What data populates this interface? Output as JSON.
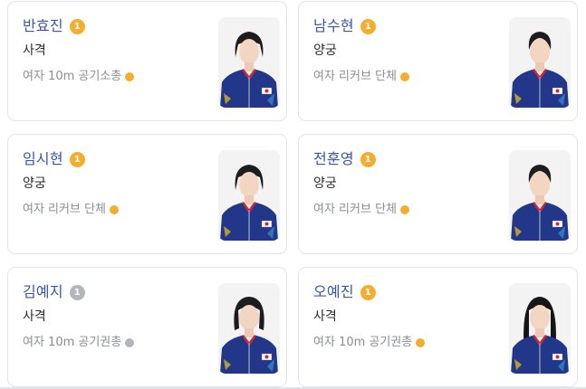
{
  "colors": {
    "gold": "#f5ad2e",
    "silver": "#b3b6ba",
    "name": "#3a56a8"
  },
  "athletes": [
    {
      "name": "반효진",
      "medal_num": "1",
      "medal_type": "gold",
      "sport": "사격",
      "event": "여자 10m 공기소총",
      "event_dot": "gold",
      "hair": "short"
    },
    {
      "name": "남수현",
      "medal_num": "1",
      "medal_type": "gold",
      "sport": "양궁",
      "event": "여자 리커브 단체",
      "event_dot": "gold",
      "hair": "tied"
    },
    {
      "name": "임시현",
      "medal_num": "1",
      "medal_type": "gold",
      "sport": "양궁",
      "event": "여자 리커브 단체",
      "event_dot": "gold",
      "hair": "short"
    },
    {
      "name": "전훈영",
      "medal_num": "1",
      "medal_type": "gold",
      "sport": "양궁",
      "event": "여자 리커브 단체",
      "event_dot": "gold",
      "hair": "tied"
    },
    {
      "name": "김예지",
      "medal_num": "1",
      "medal_type": "silver",
      "sport": "사격",
      "event": "여자 10m 공기권총",
      "event_dot": "silver",
      "hair": "bob"
    },
    {
      "name": "오예진",
      "medal_num": "1",
      "medal_type": "gold",
      "sport": "사격",
      "event": "여자 10m 공기권총",
      "event_dot": "gold",
      "hair": "long"
    }
  ]
}
